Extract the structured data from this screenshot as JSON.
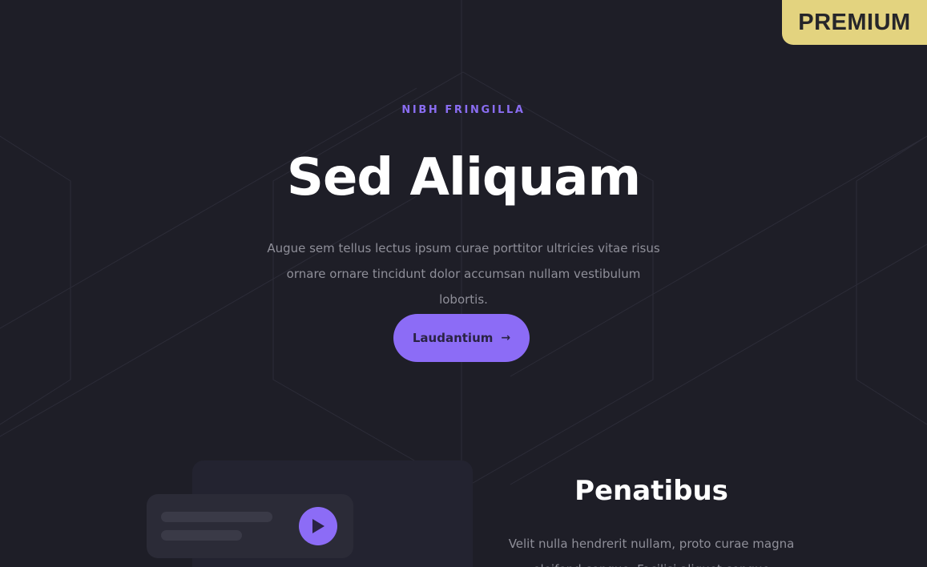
{
  "badge": {
    "label": "PREMIUM"
  },
  "hero": {
    "eyebrow": "NIBH FRINGILLA",
    "title": "Sed Aliquam",
    "subtitle": "Augue sem tellus lectus ipsum curae porttitor ultricies vitae risus ornare ornare tincidunt dolor accumsan nullam vestibulum lobortis.",
    "cta_label": "Laudantium",
    "cta_icon": "arrow-right-icon"
  },
  "feature": {
    "title": "Penatibus",
    "body": "Velit nulla hendrerit nullam, proto curae magna\neleifend congue. Facilisi aliquet congue"
  },
  "media_card": {
    "play_icon": "play-icon"
  },
  "colors": {
    "background": "#1e1e27",
    "accent": "#8c6cf6",
    "badge": "#e3d37f"
  }
}
